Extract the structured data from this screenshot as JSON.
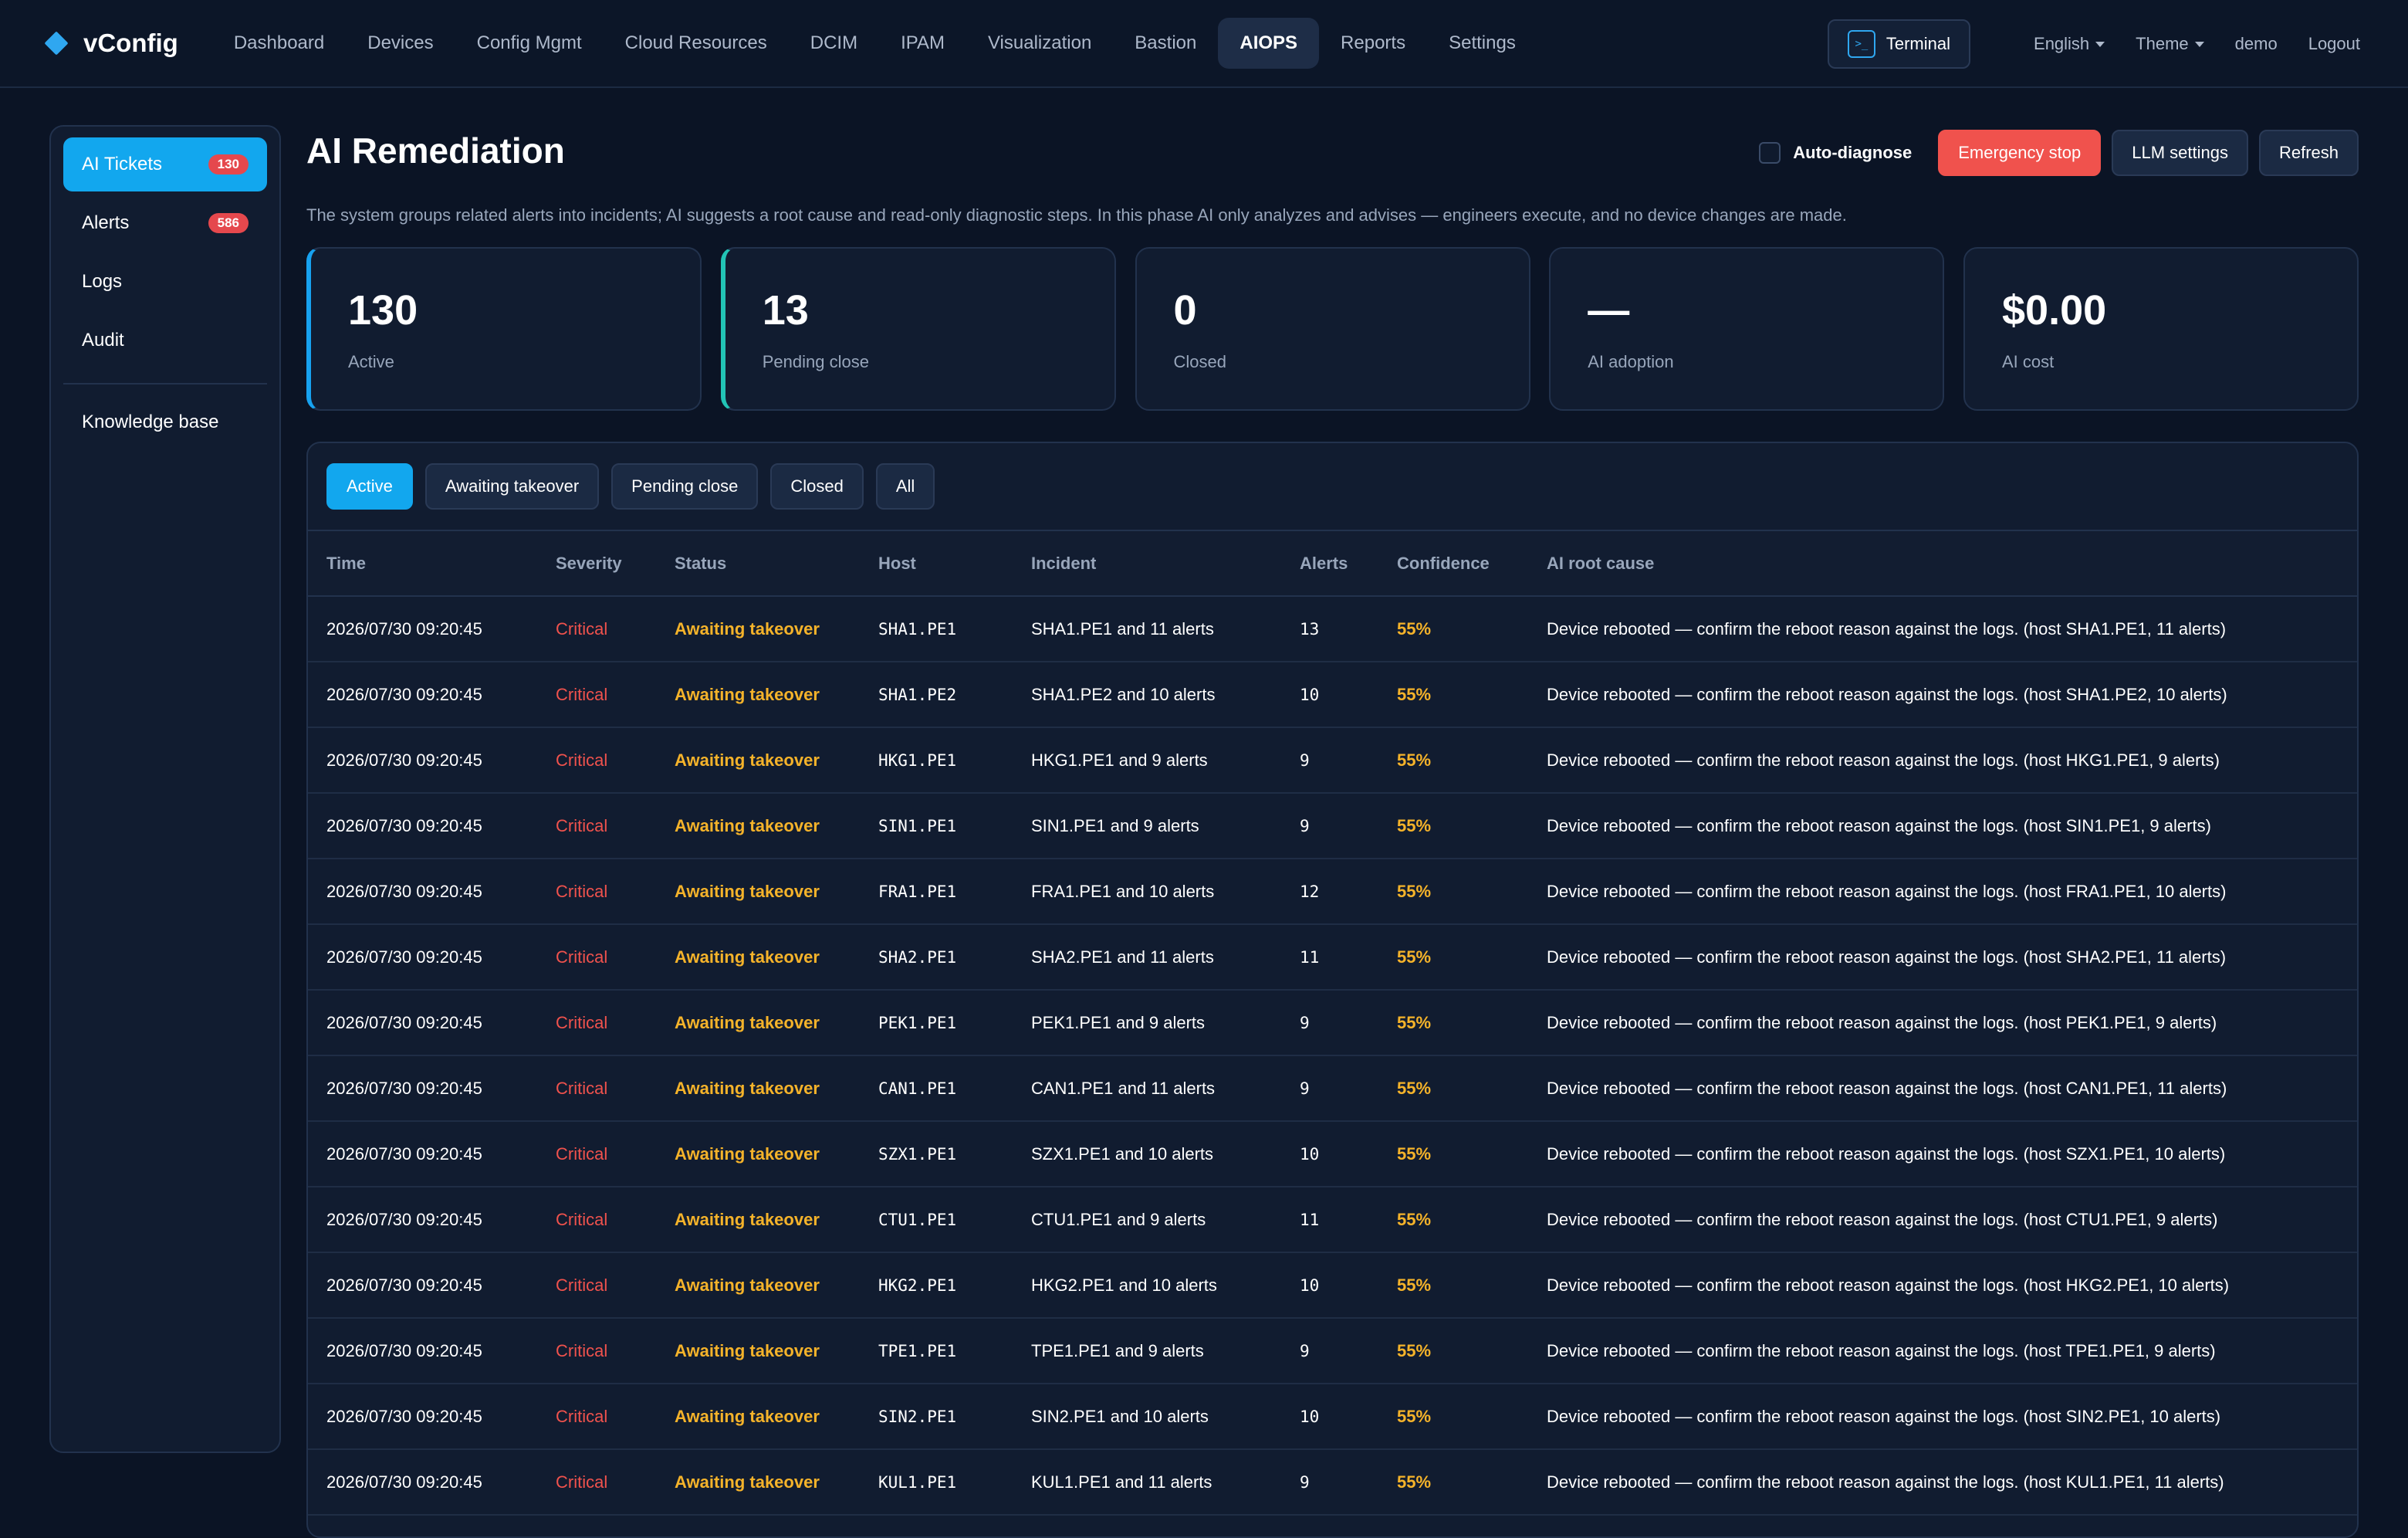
{
  "app": {
    "brand": "vConfig",
    "nav": [
      "Dashboard",
      "Devices",
      "Config Mgmt",
      "Cloud Resources",
      "DCIM",
      "IPAM",
      "Visualization",
      "Bastion",
      "AIOPS",
      "Reports",
      "Settings"
    ],
    "active_nav": "AIOPS",
    "terminal_label": "Terminal",
    "language": "English",
    "theme": "Theme",
    "user": "demo",
    "logout": "Logout"
  },
  "sidebar": {
    "items": [
      {
        "label": "AI Tickets",
        "badge": "130",
        "active": true
      },
      {
        "label": "Alerts",
        "badge": "586"
      },
      {
        "label": "Logs"
      },
      {
        "label": "Audit"
      }
    ],
    "secondary": [
      {
        "label": "Knowledge base"
      }
    ]
  },
  "page": {
    "title": "AI Remediation",
    "description": "The system groups related alerts into incidents; AI suggests a root cause and read-only diagnostic steps. In this phase AI only analyzes and advises — engineers execute, and no device changes are made.",
    "auto_diagnose_label": "Auto-diagnose",
    "buttons": {
      "emergency": "Emergency stop",
      "llm": "LLM settings",
      "refresh": "Refresh"
    }
  },
  "stats": [
    {
      "value": "130",
      "label": "Active"
    },
    {
      "value": "13",
      "label": "Pending close"
    },
    {
      "value": "0",
      "label": "Closed"
    },
    {
      "value": "—",
      "label": "AI adoption"
    },
    {
      "value": "$0.00",
      "label": "AI cost"
    }
  ],
  "filters": [
    "Active",
    "Awaiting takeover",
    "Pending close",
    "Closed",
    "All"
  ],
  "active_filter": "Active",
  "table": {
    "columns": [
      "Time",
      "Severity",
      "Status",
      "Host",
      "Incident",
      "Alerts",
      "Confidence",
      "AI root cause"
    ],
    "rows": [
      [
        "2026/07/30 09:20:45",
        "Critical",
        "Awaiting takeover",
        "SHA1.PE1",
        "SHA1.PE1 and 11 alerts",
        "13",
        "55%",
        "Device rebooted — confirm the reboot reason against the logs. (host SHA1.PE1, 11 alerts)"
      ],
      [
        "2026/07/30 09:20:45",
        "Critical",
        "Awaiting takeover",
        "SHA1.PE2",
        "SHA1.PE2 and 10 alerts",
        "10",
        "55%",
        "Device rebooted — confirm the reboot reason against the logs. (host SHA1.PE2, 10 alerts)"
      ],
      [
        "2026/07/30 09:20:45",
        "Critical",
        "Awaiting takeover",
        "HKG1.PE1",
        "HKG1.PE1 and 9 alerts",
        "9",
        "55%",
        "Device rebooted — confirm the reboot reason against the logs. (host HKG1.PE1, 9 alerts)"
      ],
      [
        "2026/07/30 09:20:45",
        "Critical",
        "Awaiting takeover",
        "SIN1.PE1",
        "SIN1.PE1 and 9 alerts",
        "9",
        "55%",
        "Device rebooted — confirm the reboot reason against the logs. (host SIN1.PE1, 9 alerts)"
      ],
      [
        "2026/07/30 09:20:45",
        "Critical",
        "Awaiting takeover",
        "FRA1.PE1",
        "FRA1.PE1 and 10 alerts",
        "12",
        "55%",
        "Device rebooted — confirm the reboot reason against the logs. (host FRA1.PE1, 10 alerts)"
      ],
      [
        "2026/07/30 09:20:45",
        "Critical",
        "Awaiting takeover",
        "SHA2.PE1",
        "SHA2.PE1 and 11 alerts",
        "11",
        "55%",
        "Device rebooted — confirm the reboot reason against the logs. (host SHA2.PE1, 11 alerts)"
      ],
      [
        "2026/07/30 09:20:45",
        "Critical",
        "Awaiting takeover",
        "PEK1.PE1",
        "PEK1.PE1 and 9 alerts",
        "9",
        "55%",
        "Device rebooted — confirm the reboot reason against the logs. (host PEK1.PE1, 9 alerts)"
      ],
      [
        "2026/07/30 09:20:45",
        "Critical",
        "Awaiting takeover",
        "CAN1.PE1",
        "CAN1.PE1 and 11 alerts",
        "9",
        "55%",
        "Device rebooted — confirm the reboot reason against the logs. (host CAN1.PE1, 11 alerts)"
      ],
      [
        "2026/07/30 09:20:45",
        "Critical",
        "Awaiting takeover",
        "SZX1.PE1",
        "SZX1.PE1 and 10 alerts",
        "10",
        "55%",
        "Device rebooted — confirm the reboot reason against the logs. (host SZX1.PE1, 10 alerts)"
      ],
      [
        "2026/07/30 09:20:45",
        "Critical",
        "Awaiting takeover",
        "CTU1.PE1",
        "CTU1.PE1 and 9 alerts",
        "11",
        "55%",
        "Device rebooted — confirm the reboot reason against the logs. (host CTU1.PE1, 9 alerts)"
      ],
      [
        "2026/07/30 09:20:45",
        "Critical",
        "Awaiting takeover",
        "HKG2.PE1",
        "HKG2.PE1 and 10 alerts",
        "10",
        "55%",
        "Device rebooted — confirm the reboot reason against the logs. (host HKG2.PE1, 10 alerts)"
      ],
      [
        "2026/07/30 09:20:45",
        "Critical",
        "Awaiting takeover",
        "TPE1.PE1",
        "TPE1.PE1 and 9 alerts",
        "9",
        "55%",
        "Device rebooted — confirm the reboot reason against the logs. (host TPE1.PE1, 9 alerts)"
      ],
      [
        "2026/07/30 09:20:45",
        "Critical",
        "Awaiting takeover",
        "SIN2.PE1",
        "SIN2.PE1 and 10 alerts",
        "10",
        "55%",
        "Device rebooted — confirm the reboot reason against the logs. (host SIN2.PE1, 10 alerts)"
      ],
      [
        "2026/07/30 09:20:45",
        "Critical",
        "Awaiting takeover",
        "KUL1.PE1",
        "KUL1.PE1 and 11 alerts",
        "9",
        "55%",
        "Device rebooted — confirm the reboot reason against the logs. (host KUL1.PE1, 11 alerts)"
      ]
    ]
  },
  "colors": {
    "accent": "#12a7ee",
    "danger": "#f0524d",
    "warning": "#f5b32a",
    "teal": "#22c4b6",
    "background": "#0b1425"
  }
}
